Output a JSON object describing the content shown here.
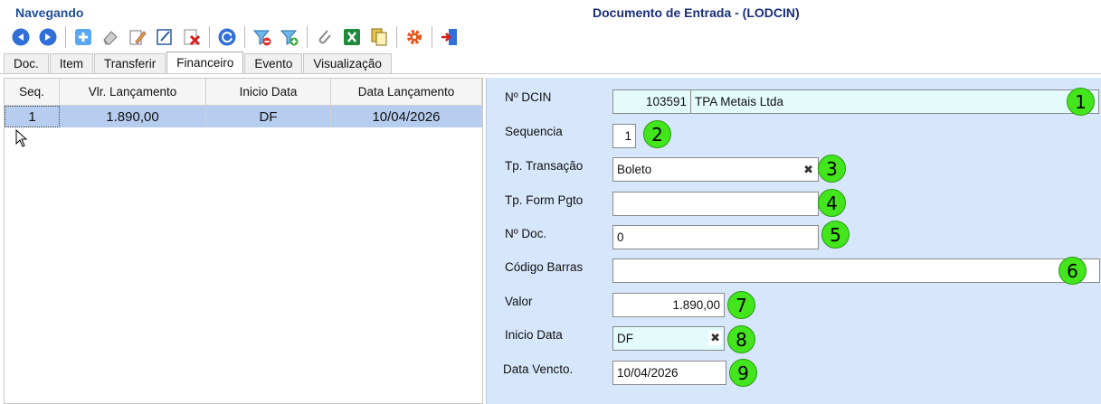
{
  "header": {
    "status": "Navegando",
    "title": "Documento de Entrada - (LODCIN)"
  },
  "toolbar": {
    "icons": [
      "arrow-left-icon",
      "arrow-right-icon",
      "add-icon",
      "eraser-icon",
      "edit-pencil-icon",
      "edit-doc-icon",
      "delete-icon",
      "refresh-icon",
      "filter-remove-icon",
      "filter-add-icon",
      "attach-icon",
      "excel-icon",
      "copy-doc-icon",
      "settings-gear-icon",
      "exit-icon"
    ]
  },
  "tabs": [
    {
      "label": "Doc."
    },
    {
      "label": "Item"
    },
    {
      "label": "Transferir"
    },
    {
      "label": "Financeiro",
      "active": true
    },
    {
      "label": "Evento"
    },
    {
      "label": "Visualização"
    }
  ],
  "grid": {
    "columns": [
      "Seq.",
      "Vlr. Lançamento",
      "Inicio Data",
      "Data Lançamento"
    ],
    "rows": [
      [
        "1",
        "1.890,00",
        "DF",
        "10/04/2026"
      ]
    ]
  },
  "form": {
    "dcin_label": "Nº DCIN",
    "dcin_number": "103591",
    "dcin_name": "TPA Metais Ltda",
    "sequencia_label": "Sequencia",
    "sequencia_value": "1",
    "tp_transacao_label": "Tp. Transação",
    "tp_transacao_value": "Boleto",
    "tp_form_pgto_label": "Tp. Form Pgto",
    "tp_form_pgto_value": "",
    "n_doc_label": "Nº Doc.",
    "n_doc_value": "0",
    "codigo_barras_label": "Código Barras",
    "codigo_barras_value": "",
    "valor_label": "Valor",
    "valor_value": "1.890,00",
    "inicio_data_label": "Inicio Data",
    "inicio_data_value": "DF",
    "data_vencto_label": "Data Vencto.",
    "data_vencto_value": "10/04/2026",
    "clear_glyph": "✖"
  },
  "badges": [
    "1",
    "2",
    "3",
    "4",
    "5",
    "6",
    "7",
    "8",
    "9"
  ],
  "colors": {
    "form_bg": "#d7e7fb",
    "selected_row": "#b7cdef",
    "badge": "#43e51c",
    "title": "#1a2f7a"
  }
}
